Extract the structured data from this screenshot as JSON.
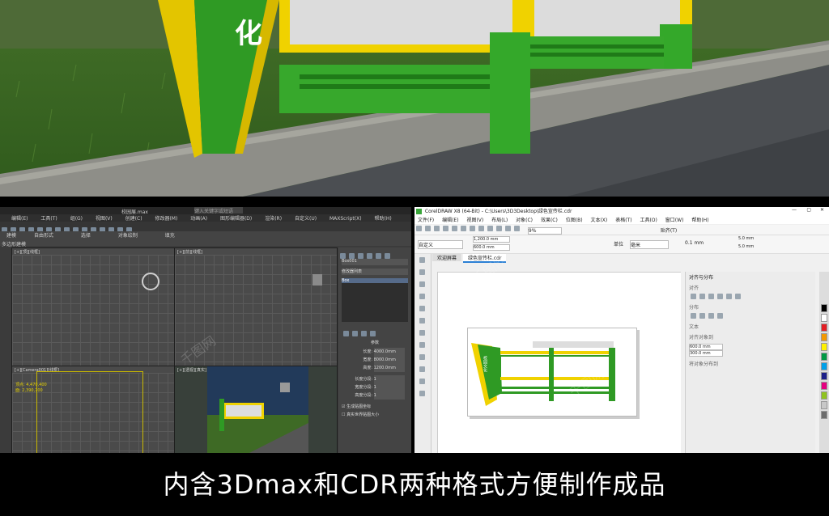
{
  "render": {
    "sign_text": "化"
  },
  "max": {
    "title": "校园展.max",
    "search_placeholder": "键入关键字或短语",
    "menu": [
      "编辑(E)",
      "工具(T)",
      "组(G)",
      "视图(V)",
      "创建(C)",
      "修改器(M)",
      "动画(A)",
      "图形编辑器(D)",
      "渲染(R)",
      "自定义(U)",
      "MAXScript(X)",
      "帮助(H)"
    ],
    "ribbon": [
      "建模",
      "自由形式",
      "选择",
      "对象绘制",
      "填充"
    ],
    "subribbon": "多边形建模",
    "panel_items": [
      "Box001",
      "修改器列表",
      "Box"
    ],
    "params_title": "参数",
    "params": [
      {
        "label": "长度:",
        "value": "4000.0mm"
      },
      {
        "label": "宽度:",
        "value": "8000.0mm"
      },
      {
        "label": "高度:",
        "value": "1200.0mm"
      },
      {
        "label": "长度分段:",
        "value": "1"
      },
      {
        "label": "宽度分段:",
        "value": "1"
      },
      {
        "label": "高度分段:",
        "value": "1"
      }
    ],
    "checkbox1": "生成贴图坐标",
    "checkbox2": "真实世界贴图大小",
    "viewport_labels": [
      "[+][顶][线框]",
      "[+][前][线框]",
      "[+][Camera001][线框]",
      "[+][透视][真实]"
    ],
    "vp_readout": [
      "顶点: 4,470,400",
      "面: 2,390,700"
    ]
  },
  "cdr": {
    "title": "CorelDRAW X8 (64-Bit) - C:\\Users\\3D3Desktop\\绿色宣传栏.cdr",
    "menu": [
      "文件(F)",
      "编辑(E)",
      "视图(V)",
      "布局(L)",
      "对象(C)",
      "效果(C)",
      "位图(B)",
      "文本(X)",
      "表格(T)",
      "工具(O)",
      "窗口(W)",
      "帮助(H)"
    ],
    "zoom": "9%",
    "snap": "贴齐(T)",
    "paper": "自定义",
    "width": "1,200.0 mm",
    "height": "600.0 mm",
    "unit_label": "单位",
    "unit": "毫米",
    "nudge": "0.1 mm",
    "dup_x": "5.0 mm",
    "dup_y": "5.0 mm",
    "tabs": [
      "欢迎屏幕",
      "绿色宣传栏.cdr"
    ],
    "docker_title": "对齐与分布",
    "docker_items": [
      "对齐",
      "分布",
      "文本",
      "对齐对象到",
      "将对象分布到"
    ],
    "pos_x": "600.0 mm",
    "pos_y": "300.0 mm",
    "sign_text": "校园文化",
    "palette": [
      "#000000",
      "#ffffff",
      "#e31e24",
      "#f39800",
      "#fff100",
      "#009944",
      "#00a0e9",
      "#1d2088",
      "#e5007f",
      "#8fc31f",
      "#c8c8c8",
      "#6c6c6c"
    ]
  },
  "watermark": "千图网",
  "caption": "内含3Dmax和CDR两种格式方便制作成品"
}
